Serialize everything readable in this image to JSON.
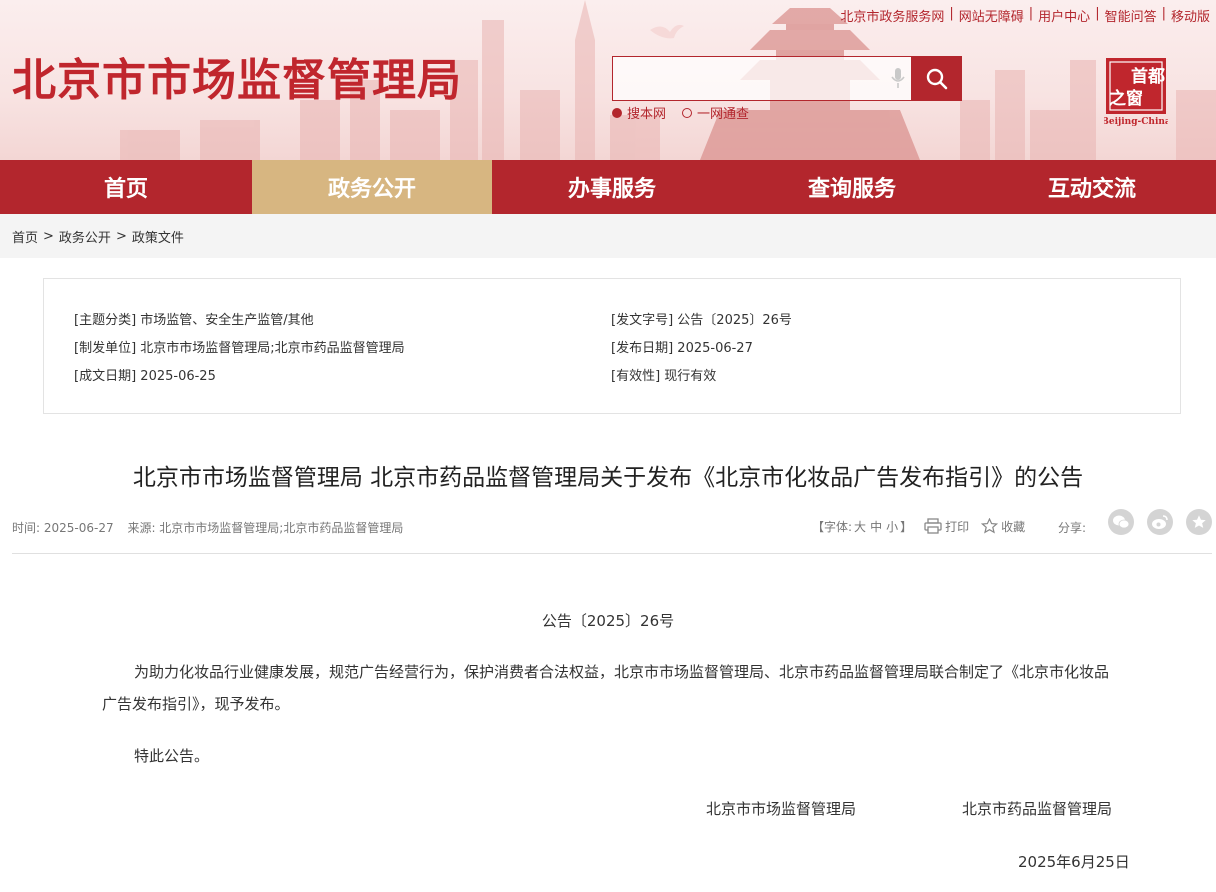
{
  "header": {
    "top_links": [
      "北京市政务服务网",
      "网站无障碍",
      "用户中心",
      "智能问答",
      "移动版"
    ],
    "site_title": "北京市市场监督管理局",
    "search_placeholder": "",
    "scope_options": [
      {
        "label": "搜本网",
        "selected": true
      },
      {
        "label": "一网通查",
        "selected": false
      }
    ],
    "logo_top": "首都",
    "logo_left": "之窗",
    "logo_sub": "Beijing-China"
  },
  "nav": {
    "items": [
      "首页",
      "政务公开",
      "办事服务",
      "查询服务",
      "互动交流"
    ],
    "active_index": 1
  },
  "breadcrumb": [
    "首页",
    "政务公开",
    "政策文件"
  ],
  "info": {
    "subject_key": "[主题分类]",
    "subject_val": "市场监管、安全生产监管/其他",
    "issuer_key": "[制发单位]",
    "issuer_val": "北京市市场监督管理局;北京市药品监督管理局",
    "created_key": "[成文日期]",
    "created_val": "2025-06-25",
    "docno_key": "[发文字号]",
    "docno_val": "公告〔2025〕26号",
    "published_key": "[发布日期]",
    "published_val": "2025-06-27",
    "validity_key": "[有效性]",
    "validity_val": "现行有效"
  },
  "article": {
    "title": "北京市市场监督管理局 北京市药品监督管理局关于发布《北京市化妆品广告发布指引》的公告",
    "time": "时间: 2025-06-27",
    "source": "来源: 北京市市场监督管理局;北京市药品监督管理局",
    "font_label_open": "【字体:",
    "font_large": "大",
    "font_medium": "中",
    "font_small": "小",
    "font_label_close": "】",
    "print": "打印",
    "favorite": "收藏",
    "share": "分享:",
    "doc_no": "公告〔2025〕26号",
    "para1": "为助力化妆品行业健康发展，规范广告经营行为，保护消费者合法权益，北京市市场监督管理局、北京市药品监督管理局联合制定了《北京市化妆品广告发布指引》，现予发布。",
    "para2": "特此公告。",
    "signer1": "北京市市场监督管理局",
    "signer2": "北京市药品监督管理局",
    "date": "2025年6月25日"
  },
  "colors": {
    "brand_red": "#b3262d",
    "nav_active": "#d7b681",
    "crumb_bg": "#f4f4f4"
  }
}
